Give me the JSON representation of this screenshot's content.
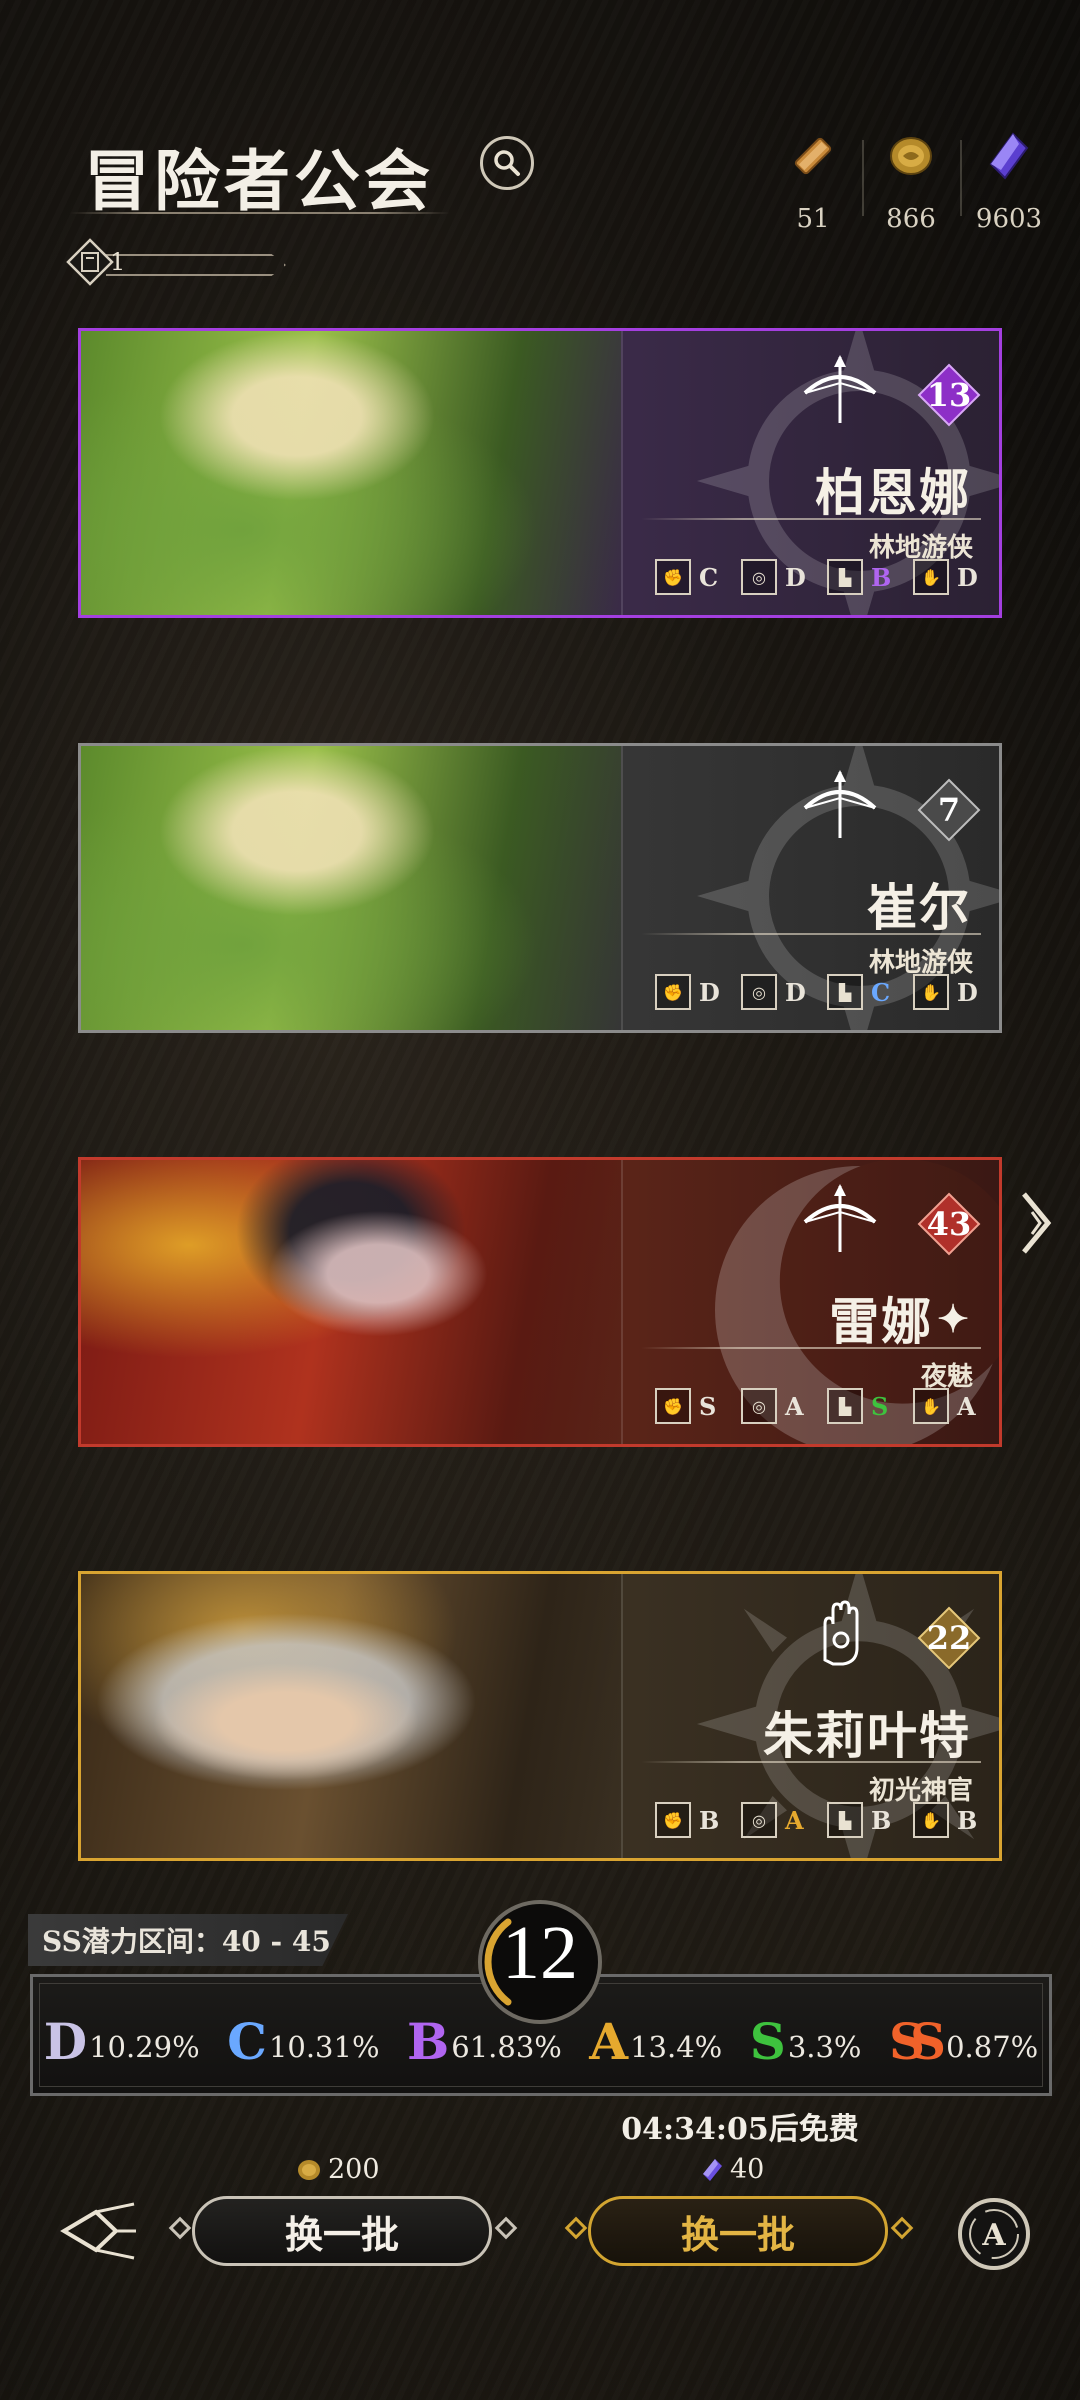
{
  "header": {
    "title": "冒险者公会",
    "counter_value": "1"
  },
  "resources": [
    {
      "name": "scroll",
      "value": "51",
      "icon": "scroll-icon"
    },
    {
      "name": "gold",
      "value": "866",
      "icon": "coin-icon"
    },
    {
      "name": "crystal",
      "value": "9603",
      "icon": "crystal-icon"
    }
  ],
  "adventurers": [
    {
      "name": "柏恩娜",
      "role": "林地游侠",
      "level": "13",
      "class_icon": "bow-icon",
      "rarity_color": "#9b3fd6",
      "stats": [
        {
          "icon": "fist-icon",
          "grade": "C"
        },
        {
          "icon": "swirl-icon",
          "grade": "D"
        },
        {
          "icon": "boot-icon",
          "grade": "B"
        },
        {
          "icon": "hand-icon",
          "grade": "D"
        }
      ]
    },
    {
      "name": "崔尔",
      "role": "林地游侠",
      "level": "7",
      "class_icon": "bow-icon",
      "rarity_color": "#8e8e8e",
      "stats": [
        {
          "icon": "fist-icon",
          "grade": "D"
        },
        {
          "icon": "swirl-icon",
          "grade": "D"
        },
        {
          "icon": "boot-icon",
          "grade": "C"
        },
        {
          "icon": "hand-icon",
          "grade": "D"
        }
      ]
    },
    {
      "name": "雷娜",
      "role": "夜魅",
      "level": "43",
      "class_icon": "bow-icon",
      "rarity_color": "#c83a2e",
      "stats": [
        {
          "icon": "fist-icon",
          "grade": "S"
        },
        {
          "icon": "swirl-icon",
          "grade": "A"
        },
        {
          "icon": "boot-icon",
          "grade": "S"
        },
        {
          "icon": "hand-icon",
          "grade": "A"
        }
      ]
    },
    {
      "name": "朱莉叶特",
      "role": "初光神官",
      "level": "22",
      "class_icon": "palm-icon",
      "rarity_color": "#d9a431",
      "stats": [
        {
          "icon": "fist-icon",
          "grade": "B"
        },
        {
          "icon": "swirl-icon",
          "grade": "A"
        },
        {
          "icon": "boot-icon",
          "grade": "B"
        },
        {
          "icon": "hand-icon",
          "grade": "B"
        }
      ]
    }
  ],
  "grade_colors": {
    "D": "#c9c3e6",
    "C": "#6aa8ff",
    "B": "#b065f0",
    "A": "#e6a92e",
    "S": "#3ec23e",
    "SS": "#f0622a"
  },
  "potential": {
    "label": "SS潜力区间：40 - 45",
    "level": "12",
    "probabilities": [
      {
        "grade": "D",
        "percent": "10.29%"
      },
      {
        "grade": "C",
        "percent": "10.31%"
      },
      {
        "grade": "B",
        "percent": "61.83%"
      },
      {
        "grade": "A",
        "percent": "13.4%"
      },
      {
        "grade": "S",
        "percent": "3.3%"
      },
      {
        "grade": "SS",
        "percent": "0.87%"
      }
    ]
  },
  "refresh": {
    "timer_text": "04:34:05后免费",
    "gold_cost": "200",
    "crystal_cost": "40",
    "button_gold_label": "换一批",
    "button_crystal_label": "换一批"
  }
}
